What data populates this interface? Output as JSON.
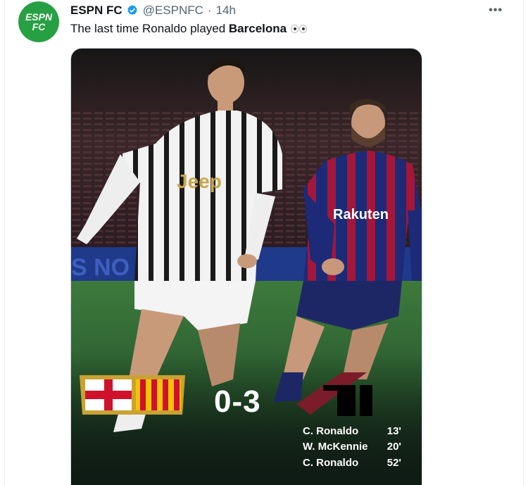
{
  "tweet": {
    "author_name": "ESPN FC",
    "handle": "@ESPNFC",
    "time_sep": "·",
    "time": "14h",
    "text_prefix": "The last time Ronaldo played ",
    "text_bold": "Barcelona",
    "avatar_line1": "ESPN",
    "avatar_line2": "FC",
    "more_label": "•••",
    "avatar_color": "#27a043",
    "verified_color": "#1d9bf0"
  },
  "media": {
    "banner_text": "S NO",
    "shirt_sponsor_left": "Jeep",
    "shirt_sponsor_right": "Rakuten",
    "score": "0-3",
    "scorers": [
      {
        "name": "C. Ronaldo",
        "minute": "13'"
      },
      {
        "name": "W. McKennie",
        "minute": "20'"
      },
      {
        "name": "C. Ronaldo",
        "minute": "52'"
      }
    ]
  }
}
